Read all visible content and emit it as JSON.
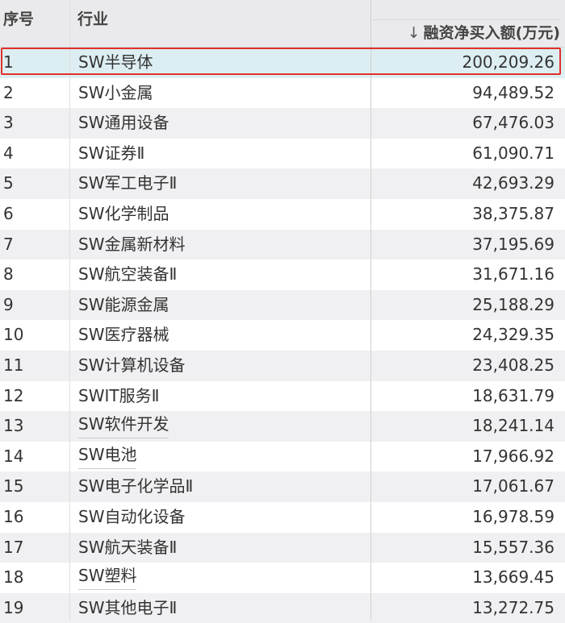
{
  "header": {
    "index_label": "序号",
    "industry_label": "行业",
    "sort_arrow": "↓",
    "value_label": "融资净买入额(万元)"
  },
  "colors": {
    "highlight_border": "#e0302a",
    "selected_row": "#ddeef3",
    "alt_row": "#f0f0f2"
  },
  "rows": [
    {
      "idx": "1",
      "name": "SW半导体",
      "value": "200,209.26"
    },
    {
      "idx": "2",
      "name": "SW小金属",
      "value": "94,489.52"
    },
    {
      "idx": "3",
      "name": "SW通用设备",
      "value": "67,476.03"
    },
    {
      "idx": "4",
      "name": "SW证券Ⅱ",
      "value": "61,090.71"
    },
    {
      "idx": "5",
      "name": "SW军工电子Ⅱ",
      "value": "42,693.29"
    },
    {
      "idx": "6",
      "name": "SW化学制品",
      "value": "38,375.87"
    },
    {
      "idx": "7",
      "name": "SW金属新材料",
      "value": "37,195.69"
    },
    {
      "idx": "8",
      "name": "SW航空装备Ⅱ",
      "value": "31,671.16"
    },
    {
      "idx": "9",
      "name": "SW能源金属",
      "value": "25,188.29"
    },
    {
      "idx": "10",
      "name": "SW医疗器械",
      "value": "24,329.35"
    },
    {
      "idx": "11",
      "name": "SW计算机设备",
      "value": "23,408.25"
    },
    {
      "idx": "12",
      "name": "SWIT服务Ⅱ",
      "value": "18,631.79"
    },
    {
      "idx": "13",
      "name": "SW软件开发",
      "value": "18,241.14"
    },
    {
      "idx": "14",
      "name": "SW电池",
      "value": "17,966.92"
    },
    {
      "idx": "15",
      "name": "SW电子化学品Ⅱ",
      "value": "17,061.67"
    },
    {
      "idx": "16",
      "name": "SW自动化设备",
      "value": "16,978.59"
    },
    {
      "idx": "17",
      "name": "SW航天装备Ⅱ",
      "value": "15,557.36"
    },
    {
      "idx": "18",
      "name": "SW塑料",
      "value": "13,669.45"
    },
    {
      "idx": "19",
      "name": "SW其他电子Ⅱ",
      "value": "13,272.75"
    }
  ]
}
